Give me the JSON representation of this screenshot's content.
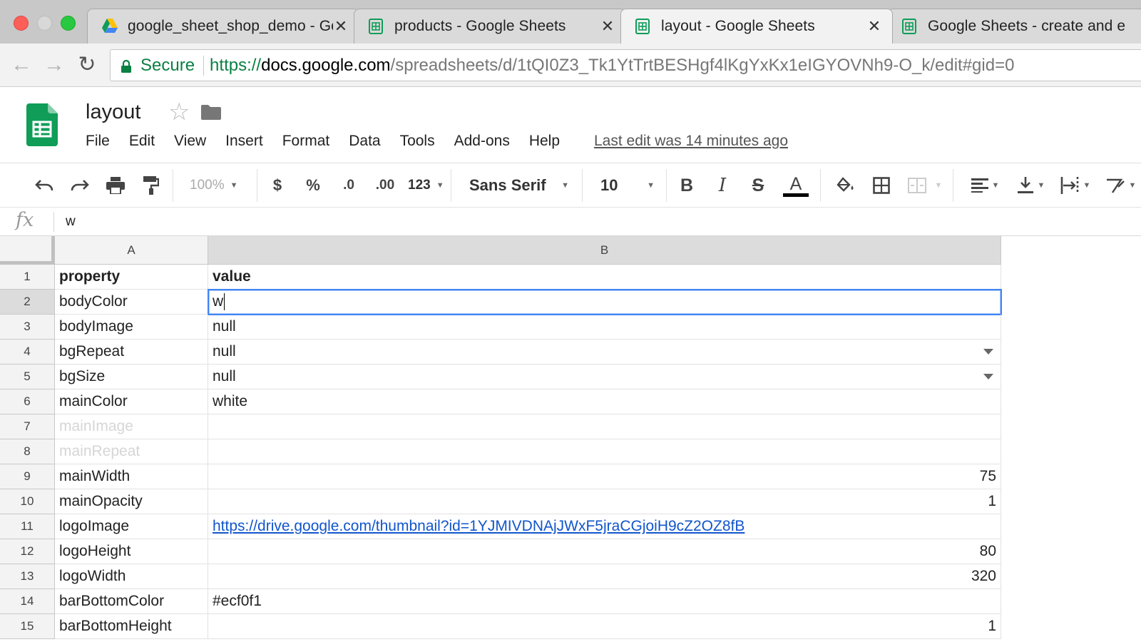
{
  "browser": {
    "tabs": [
      {
        "title": "google_sheet_shop_demo - Go",
        "icon": "drive-icon"
      },
      {
        "title": "products - Google Sheets",
        "icon": "sheets-icon"
      },
      {
        "title": "layout - Google Sheets",
        "icon": "sheets-icon",
        "active": true
      },
      {
        "title": "Google Sheets - create and e",
        "icon": "sheets-icon"
      }
    ],
    "close_glyph": "✕",
    "secure_label": "Secure",
    "url_scheme": "https://",
    "url_host": "docs.google.com",
    "url_path": "/spreadsheets/d/1tQI0Z3_Tk1YtTrtBESHgf4lKgYxKx1eIGYOVNh9-O_k/edit#gid=0"
  },
  "doc": {
    "title": "layout",
    "menu": [
      "File",
      "Edit",
      "View",
      "Insert",
      "Format",
      "Data",
      "Tools",
      "Add-ons",
      "Help"
    ],
    "last_edit": "Last edit was 14 minutes ago"
  },
  "toolbar": {
    "zoom": "100%",
    "currency": "$",
    "percent": "%",
    "dec_less": ".0",
    "dec_more": ".00",
    "more_formats": "123",
    "font": "Sans Serif",
    "font_size": "10",
    "bold": "B",
    "italic": "I",
    "strike": "S",
    "text_color": "A"
  },
  "formula": {
    "fx": "fx",
    "content": "w"
  },
  "grid": {
    "columns": [
      "A",
      "B"
    ],
    "selected_column": "B",
    "selected_row": "2",
    "rows": [
      {
        "n": "1",
        "a": "property",
        "b": "value",
        "header": true
      },
      {
        "n": "2",
        "a": "bodyColor",
        "b": "w",
        "editing": true
      },
      {
        "n": "3",
        "a": "bodyImage",
        "b": "null"
      },
      {
        "n": "4",
        "a": "bgRepeat",
        "b": "null",
        "dropdown": true
      },
      {
        "n": "5",
        "a": "bgSize",
        "b": "null",
        "dropdown": true
      },
      {
        "n": "6",
        "a": "mainColor",
        "b": "white"
      },
      {
        "n": "7",
        "a": "mainImage",
        "b": "",
        "faded": true
      },
      {
        "n": "8",
        "a": "mainRepeat",
        "b": "",
        "faded": true
      },
      {
        "n": "9",
        "a": "mainWidth",
        "b": "75",
        "numeric": true
      },
      {
        "n": "10",
        "a": "mainOpacity",
        "b": "1",
        "numeric": true
      },
      {
        "n": "11",
        "a": "logoImage",
        "b": "https://drive.google.com/thumbnail?id=1YJMIVDNAjJWxF5jraCGjoiH9cZ2OZ8fB",
        "link": true
      },
      {
        "n": "12",
        "a": "logoHeight",
        "b": "80",
        "numeric": true
      },
      {
        "n": "13",
        "a": "logoWidth",
        "b": "320",
        "numeric": true
      },
      {
        "n": "14",
        "a": "barBottomColor",
        "b": "#ecf0f1"
      },
      {
        "n": "15",
        "a": "barBottomHeight",
        "b": "1",
        "numeric": true
      }
    ]
  },
  "colors": {
    "sheets_green": "#0f9d58",
    "selection_blue": "#4285f4",
    "link_blue": "#1155cc",
    "secure_green": "#0b8043"
  }
}
